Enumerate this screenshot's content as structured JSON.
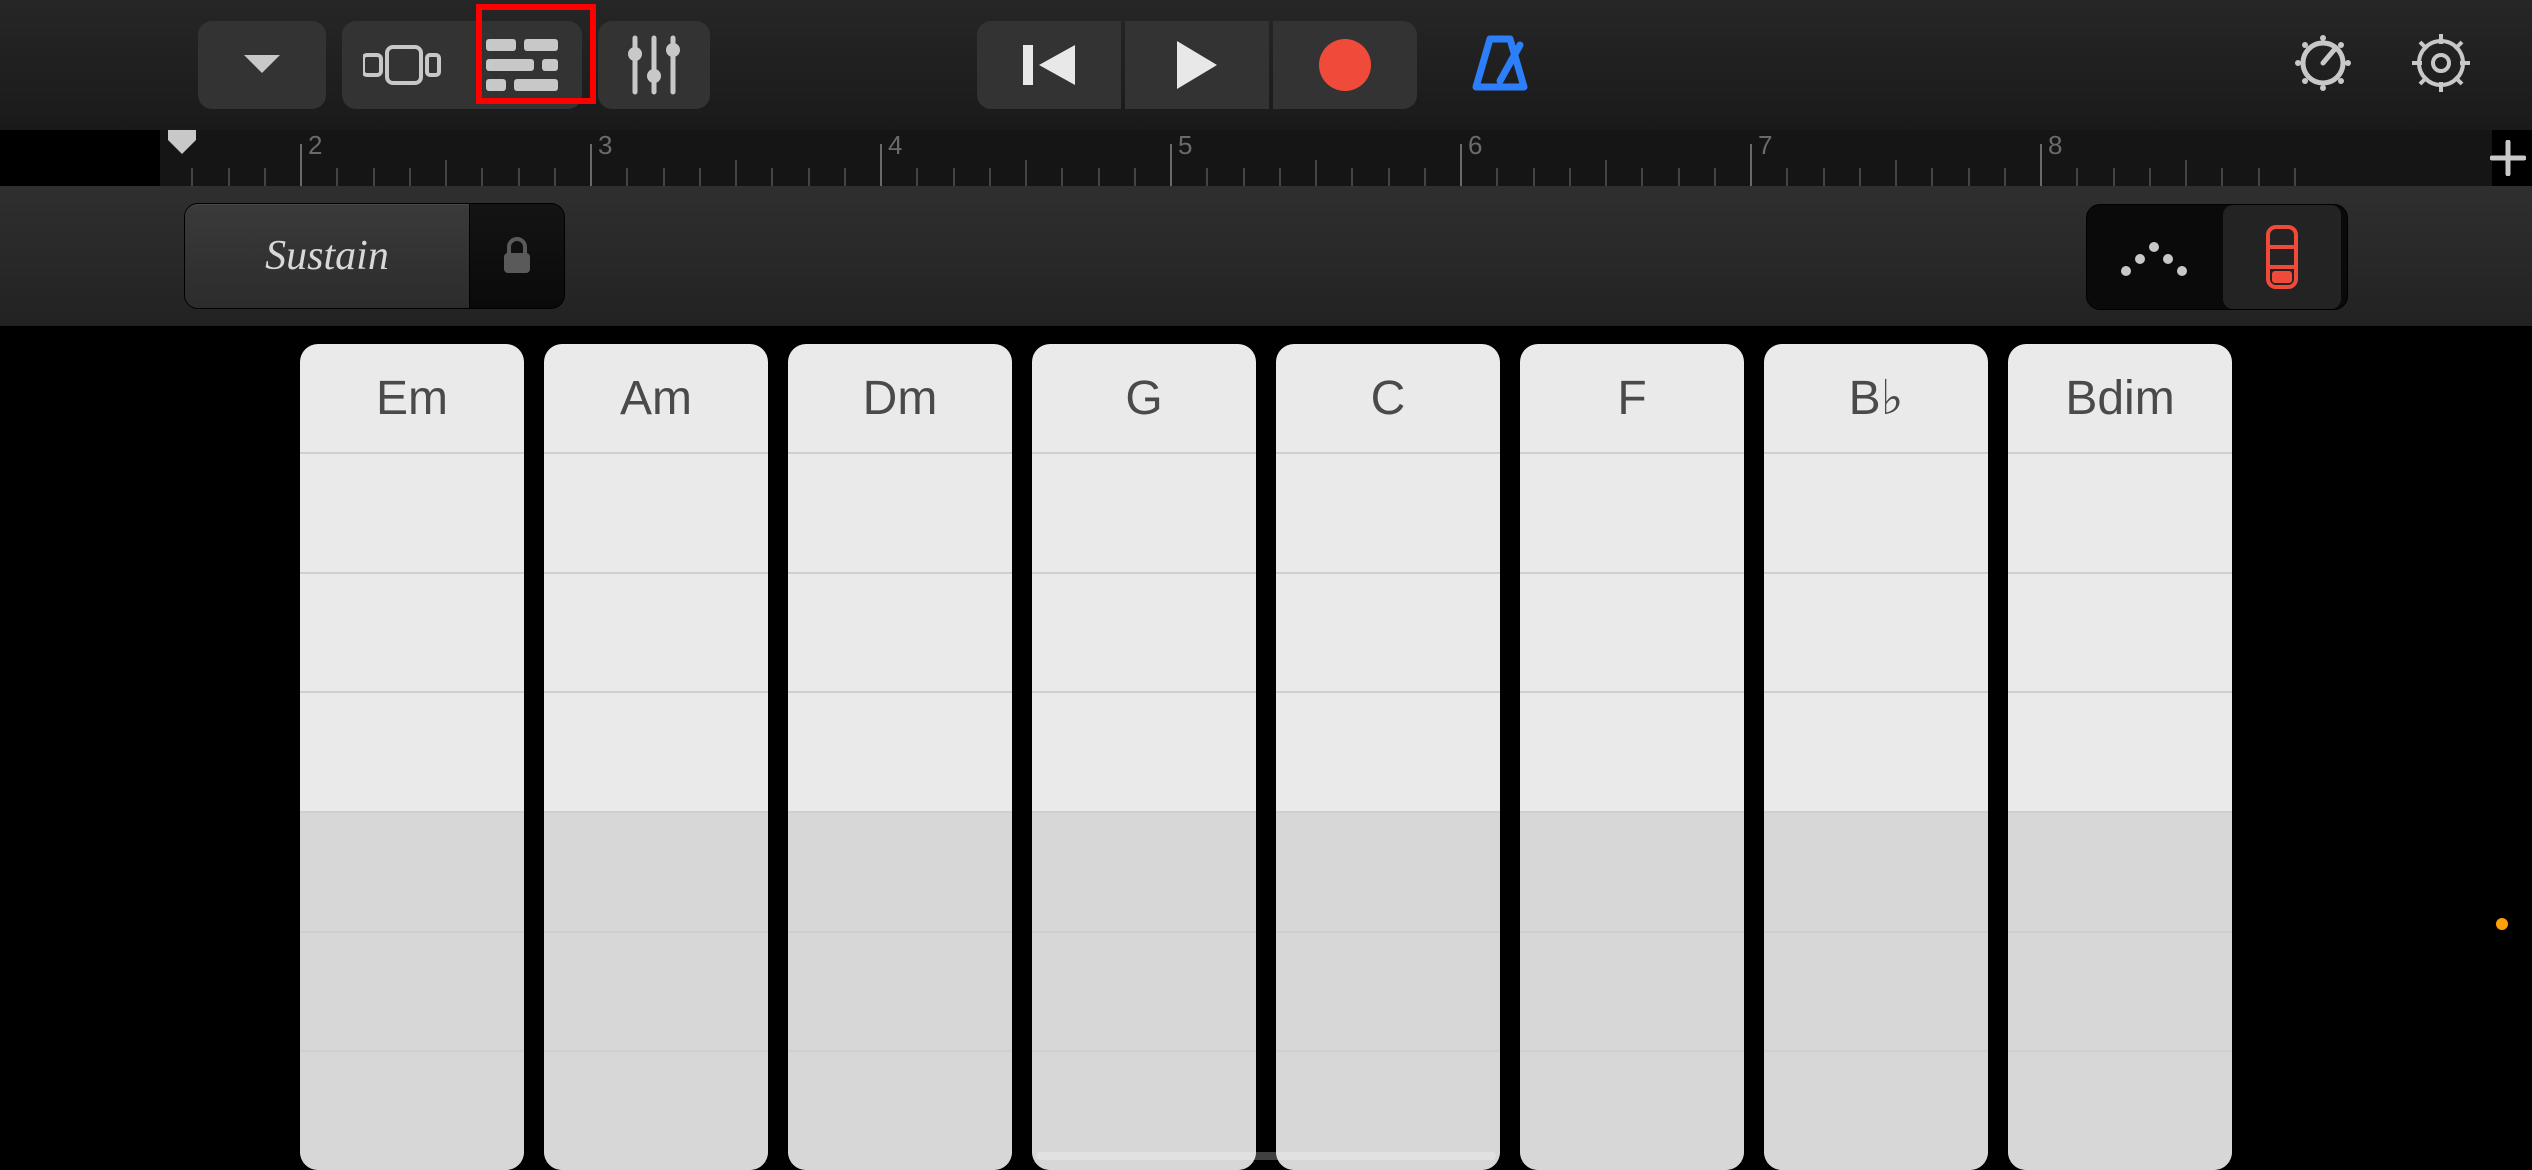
{
  "colors": {
    "accent_blue": "#2d7ff9",
    "record_red": "#f04b3a"
  },
  "toolbar": {
    "icons": {
      "track_dropdown": "chevron-down",
      "view_browser": "grid",
      "view_tracks": "tracks",
      "fx": "sliders",
      "go_to_start": "skip-back",
      "play": "play",
      "record": "record",
      "metronome": "metronome",
      "live_loops": "loop-dial",
      "settings": "gear"
    }
  },
  "ruler": {
    "bars": [
      "2",
      "3",
      "4",
      "5",
      "6",
      "7",
      "8"
    ]
  },
  "subbar": {
    "sustain_label": "Sustain",
    "lock_icon": "lock",
    "right_seg": {
      "option_a_icon": "arpeggiator",
      "option_b_icon": "chord-strip",
      "active": "b"
    }
  },
  "chords": [
    "Em",
    "Am",
    "Dm",
    "G",
    "C",
    "F",
    "B♭",
    "Bdim"
  ]
}
